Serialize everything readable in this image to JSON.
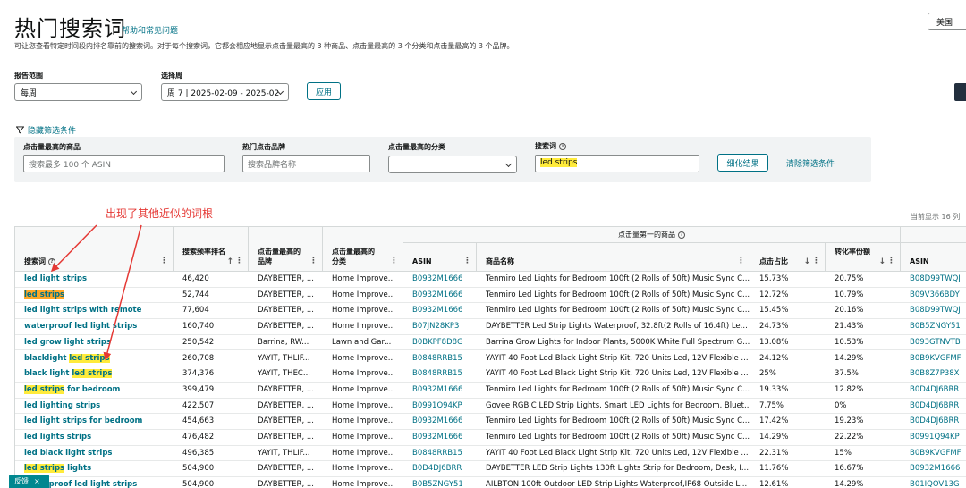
{
  "header": {
    "title": "热门搜索词",
    "help_link": "帮助和常见问题",
    "subtitle": "可让您查看特定时间段内排名靠前的搜索词。对于每个搜索词，它都会相应地显示点击量最高的 3 种商品、点击量最高的 3 个分类和点击量最高的 3 个品牌。",
    "region": "美国"
  },
  "controls": {
    "report_range_label": "报告范围",
    "report_range_value": "每周",
    "week_label": "选择周",
    "week_value": "周 7 | 2025-02-09 - 2025-02",
    "apply_button": "应用"
  },
  "filters": {
    "toggle_label": "隐藏筛选条件",
    "product_label": "点击量最高的商品",
    "product_placeholder": "搜索最多 100 个 ASIN",
    "brand_label": "热门点击品牌",
    "brand_placeholder": "搜索品牌名称",
    "category_label": "点击量最高的分类",
    "category_value": "",
    "term_label": "搜索词",
    "term_value": "led strips",
    "refine_button": "细化结果",
    "clear_link": "清除筛选条件"
  },
  "annotation": "出现了其他近似的词根",
  "count_text": "当前显示 16 列",
  "table": {
    "group_header": "点击量第一的商品",
    "headers": {
      "term": "搜索词",
      "rank": "搜索频率排名",
      "brand": "点击量最高的品牌",
      "category": "点击量最高的分类",
      "asin": "ASIN",
      "product": "商品名称",
      "click_share": "点击占比",
      "conversion": "转化率份额",
      "asin2": "ASIN"
    },
    "rows": [
      {
        "term_pre": "led light strips",
        "term_hl": "",
        "term_post": "",
        "rank": "46,420",
        "brand": "DAYBETTER, ...",
        "category": "Home Improve...",
        "asin": "B0932M1666",
        "product": "Tenmiro Led Lights for Bedroom 100ft (2 Rolls of 50ft) Music Sync C...",
        "click": "15.73%",
        "conv": "20.75%",
        "asin2": "B08D99TWQJ"
      },
      {
        "term_pre": "",
        "term_hl": "led strips",
        "term_post": "",
        "hl_style": "orange",
        "rank": "52,744",
        "brand": "DAYBETTER, ...",
        "category": "Home Improve...",
        "asin": "B0932M1666",
        "product": "Tenmiro Led Lights for Bedroom 100ft (2 Rolls of 50ft) Music Sync C...",
        "click": "12.72%",
        "conv": "10.79%",
        "asin2": "B09V366BDY"
      },
      {
        "term_pre": "led light strips with remote",
        "term_hl": "",
        "term_post": "",
        "rank": "77,604",
        "brand": "DAYBETTER, ...",
        "category": "Home Improve...",
        "asin": "B0932M1666",
        "product": "Tenmiro Led Lights for Bedroom 100ft (2 Rolls of 50ft) Music Sync C...",
        "click": "15.45%",
        "conv": "20.16%",
        "asin2": "B08D99TWQJ"
      },
      {
        "term_pre": "waterproof led light strips",
        "term_hl": "",
        "term_post": "",
        "rank": "160,740",
        "brand": "DAYBETTER, ...",
        "category": "Home Improve...",
        "asin": "B07JN28KP3",
        "product": "DAYBETTER Led Strip Lights Waterproof, 32.8ft(2 Rolls of 16.4ft) Le...",
        "click": "24.73%",
        "conv": "21.43%",
        "asin2": "B0B5ZNGY51"
      },
      {
        "term_pre": "led grow light strips",
        "term_hl": "",
        "term_post": "",
        "rank": "250,542",
        "brand": "Barrina, RW...",
        "category": "Lawn and Gar...",
        "asin": "B0BKPF8D8G",
        "product": "Barrina Grow Lights for Indoor Plants, 5000K White Full Spectrum G...",
        "click": "13.08%",
        "conv": "10.53%",
        "asin2": "B093GTNVTB"
      },
      {
        "term_pre": "blacklight ",
        "term_hl": "led strips",
        "term_post": "",
        "rank": "260,708",
        "brand": "YAYIT, THLIF...",
        "category": "Home Improve...",
        "asin": "B0848RRB15",
        "product": "YAYIT 40 Foot Led Black Light Strip Kit, 720 Units Led, 12V Flexible ...",
        "click": "24.12%",
        "conv": "14.29%",
        "asin2": "B0B9KVGFMF"
      },
      {
        "term_pre": "black light ",
        "term_hl": "led strips",
        "term_post": "",
        "rank": "374,376",
        "brand": "YAYIT, THEC...",
        "category": "Home Improve...",
        "asin": "B0848RRB15",
        "product": "YAYIT 40 Foot Led Black Light Strip Kit, 720 Units Led, 12V Flexible ...",
        "click": "25%",
        "conv": "37.5%",
        "asin2": "B0B8Z7P38X"
      },
      {
        "term_pre": "",
        "term_hl": "led strips",
        "term_post": " for bedroom",
        "rank": "399,479",
        "brand": "DAYBETTER, ...",
        "category": "Home Improve...",
        "asin": "B0932M1666",
        "product": "Tenmiro Led Lights for Bedroom 100ft (2 Rolls of 50ft) Music Sync C...",
        "click": "19.33%",
        "conv": "12.82%",
        "asin2": "B0D4DJ6BRR"
      },
      {
        "term_pre": "led lighting strips",
        "term_hl": "",
        "term_post": "",
        "rank": "422,507",
        "brand": "DAYBETTER, ...",
        "category": "Home Improve...",
        "asin": "B0991Q94KP",
        "product": "Govee RGBIC LED Strip Lights, Smart LED Lights for Bedroom, Bluet...",
        "click": "7.75%",
        "conv": "0%",
        "asin2": "B0D4DJ6BRR"
      },
      {
        "term_pre": "led light strips for bedroom",
        "term_hl": "",
        "term_post": "",
        "rank": "454,663",
        "brand": "DAYBETTER, ...",
        "category": "Home Improve...",
        "asin": "B0932M1666",
        "product": "Tenmiro Led Lights for Bedroom 100ft (2 Rolls of 50ft) Music Sync C...",
        "click": "17.42%",
        "conv": "19.23%",
        "asin2": "B0D4DJ6BRR"
      },
      {
        "term_pre": "led lights strips",
        "term_hl": "",
        "term_post": "",
        "rank": "476,482",
        "brand": "DAYBETTER, ...",
        "category": "Home Improve...",
        "asin": "B0932M1666",
        "product": "Tenmiro Led Lights for Bedroom 100ft (2 Rolls of 50ft) Music Sync C...",
        "click": "14.29%",
        "conv": "22.22%",
        "asin2": "B0991Q94KP"
      },
      {
        "term_pre": "led black light strips",
        "term_hl": "",
        "term_post": "",
        "rank": "496,385",
        "brand": "YAYIT, THLIF...",
        "category": "Home Improve...",
        "asin": "B0848RRB15",
        "product": "YAYIT 40 Foot Led Black Light Strip Kit, 720 Units Led, 12V Flexible ...",
        "click": "22.31%",
        "conv": "15%",
        "asin2": "B0B9KVGFMF"
      },
      {
        "term_pre": "",
        "term_hl": "led strips",
        "term_post": " lights",
        "rank": "504,900",
        "brand": "DAYBETTER, ...",
        "category": "Home Improve...",
        "asin": "B0D4DJ6BRR",
        "product": "DAYBETTER LED Strip Lights 130ft Lights Strip for Bedroom, Desk, I...",
        "click": "11.76%",
        "conv": "16.67%",
        "asin2": "B0932M1666"
      },
      {
        "term_pre": "waterproof led light strips",
        "term_hl": "",
        "term_post": "",
        "rank": "504,900",
        "brand": "DAYBETTER, ...",
        "category": "Home Improve...",
        "asin": "B0B5ZNGY51",
        "product": "AILBTON 100ft Outdoor LED Strip Lights Waterproof,IP68 Outside L...",
        "click": "12.61%",
        "conv": "14.29%",
        "asin2": "B01IQOV13G"
      }
    ]
  },
  "feedback": {
    "label": "反馈",
    "close": "×"
  },
  "colors": {
    "link": "#007185",
    "highlight": "#ffeb3b",
    "highlight_alt": "#ffa726",
    "annotation": "#e53935"
  }
}
